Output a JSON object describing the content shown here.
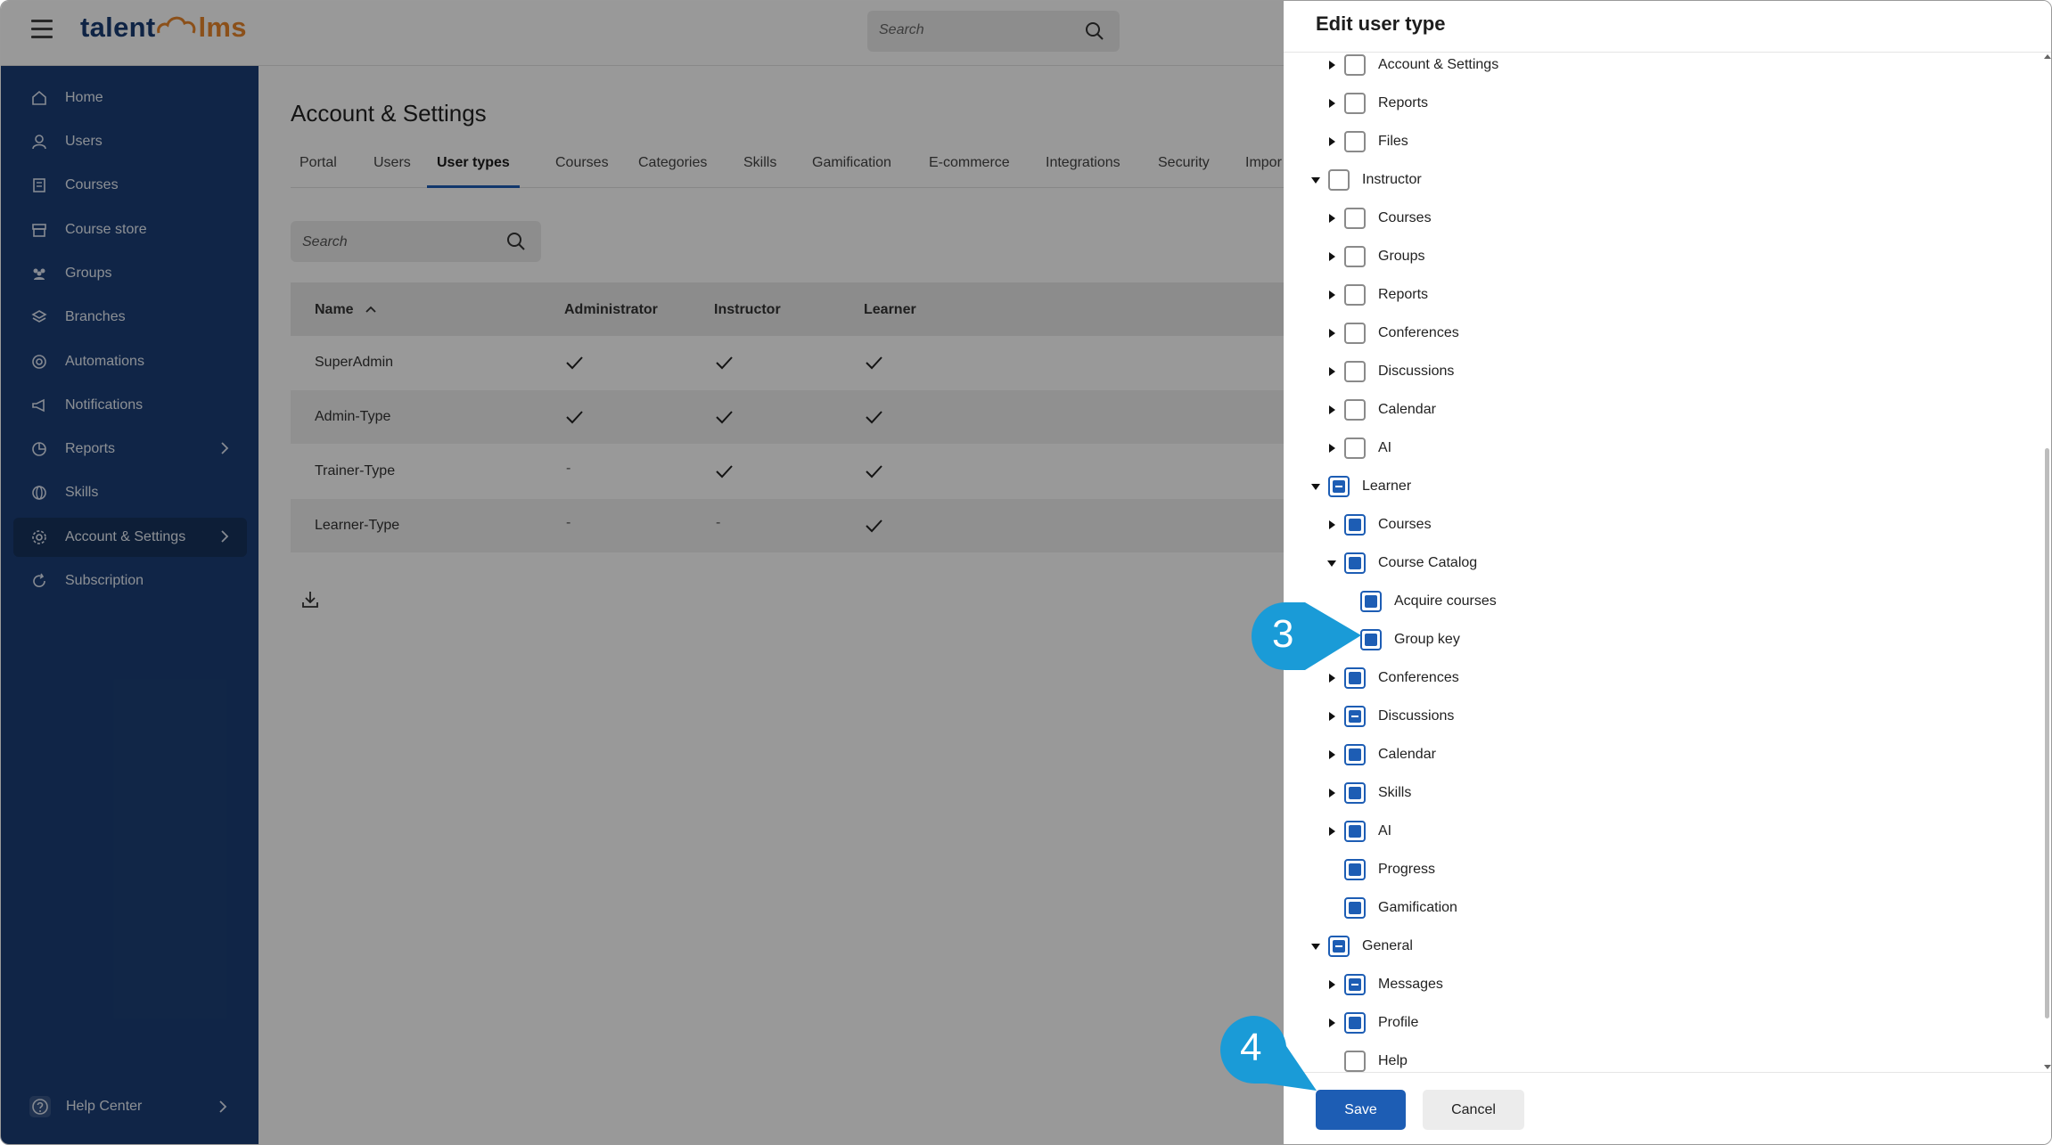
{
  "header": {
    "logo_part1": "talent",
    "logo_part2": "lms",
    "search_placeholder": "Search"
  },
  "sidebar": {
    "items": [
      {
        "label": "Home",
        "icon": "home-icon"
      },
      {
        "label": "Users",
        "icon": "user-icon"
      },
      {
        "label": "Courses",
        "icon": "book-icon"
      },
      {
        "label": "Course store",
        "icon": "store-icon"
      },
      {
        "label": "Groups",
        "icon": "groups-icon"
      },
      {
        "label": "Branches",
        "icon": "layers-icon"
      },
      {
        "label": "Automations",
        "icon": "automation-icon"
      },
      {
        "label": "Notifications",
        "icon": "megaphone-icon"
      },
      {
        "label": "Reports",
        "icon": "chart-icon"
      },
      {
        "label": "Skills",
        "icon": "globe-icon"
      },
      {
        "label": "Account & Settings",
        "icon": "gear-icon"
      },
      {
        "label": "Subscription",
        "icon": "refresh-icon"
      }
    ],
    "help_center": "Help Center"
  },
  "main": {
    "title": "Account & Settings",
    "tabs": [
      "Portal",
      "Users",
      "User types",
      "Courses",
      "Categories",
      "Skills",
      "Gamification",
      "E-commerce",
      "Integrations",
      "Security",
      "Impor"
    ],
    "active_tab": "User types",
    "search_placeholder": "Search",
    "table": {
      "headers": [
        "Name",
        "Administrator",
        "Instructor",
        "Learner"
      ],
      "rows": [
        {
          "name": "SuperAdmin",
          "administrator": "check",
          "instructor": "check",
          "learner": "check"
        },
        {
          "name": "Admin-Type",
          "administrator": "check",
          "instructor": "check",
          "learner": "check"
        },
        {
          "name": "Trainer-Type",
          "administrator": "-",
          "instructor": "check",
          "learner": "check"
        },
        {
          "name": "Learner-Type",
          "administrator": "-",
          "instructor": "-",
          "learner": "check"
        }
      ]
    }
  },
  "panel": {
    "title": "Edit user type",
    "tree": [
      {
        "label": "Account & Settings",
        "arrow": "right",
        "state": "off"
      },
      {
        "label": "Reports",
        "arrow": "right",
        "state": "off"
      },
      {
        "label": "Files",
        "arrow": "right",
        "state": "off"
      },
      {
        "label": "Instructor",
        "arrow": "down",
        "state": "off"
      },
      {
        "label": "Courses",
        "arrow": "right",
        "state": "off"
      },
      {
        "label": "Groups",
        "arrow": "right",
        "state": "off"
      },
      {
        "label": "Reports",
        "arrow": "right",
        "state": "off"
      },
      {
        "label": "Conferences",
        "arrow": "right",
        "state": "off"
      },
      {
        "label": "Discussions",
        "arrow": "right",
        "state": "off"
      },
      {
        "label": "Calendar",
        "arrow": "right",
        "state": "off"
      },
      {
        "label": "AI",
        "arrow": "right",
        "state": "off"
      },
      {
        "label": "Learner",
        "arrow": "down",
        "state": "partial"
      },
      {
        "label": "Courses",
        "arrow": "right",
        "state": "on"
      },
      {
        "label": "Course Catalog",
        "arrow": "down",
        "state": "on"
      },
      {
        "label": "Acquire courses",
        "arrow": "none",
        "state": "on"
      },
      {
        "label": "Group key",
        "arrow": "none",
        "state": "on"
      },
      {
        "label": "Conferences",
        "arrow": "right",
        "state": "on"
      },
      {
        "label": "Discussions",
        "arrow": "right",
        "state": "partial"
      },
      {
        "label": "Calendar",
        "arrow": "right",
        "state": "on"
      },
      {
        "label": "Skills",
        "arrow": "right",
        "state": "on"
      },
      {
        "label": "AI",
        "arrow": "right",
        "state": "on"
      },
      {
        "label": "Progress",
        "arrow": "none",
        "state": "on"
      },
      {
        "label": "Gamification",
        "arrow": "none",
        "state": "on"
      },
      {
        "label": "General",
        "arrow": "down",
        "state": "partial"
      },
      {
        "label": "Messages",
        "arrow": "right",
        "state": "partial"
      },
      {
        "label": "Profile",
        "arrow": "right",
        "state": "on"
      },
      {
        "label": "Help",
        "arrow": "none",
        "state": "off"
      }
    ],
    "save_label": "Save",
    "cancel_label": "Cancel"
  },
  "callouts": {
    "step3": "3",
    "step4": "4"
  },
  "colors": {
    "sidebar_bg": "#1c3f77",
    "primary": "#1d5db4",
    "callout": "#1a9bd7",
    "logo_orange": "#e8862c"
  }
}
